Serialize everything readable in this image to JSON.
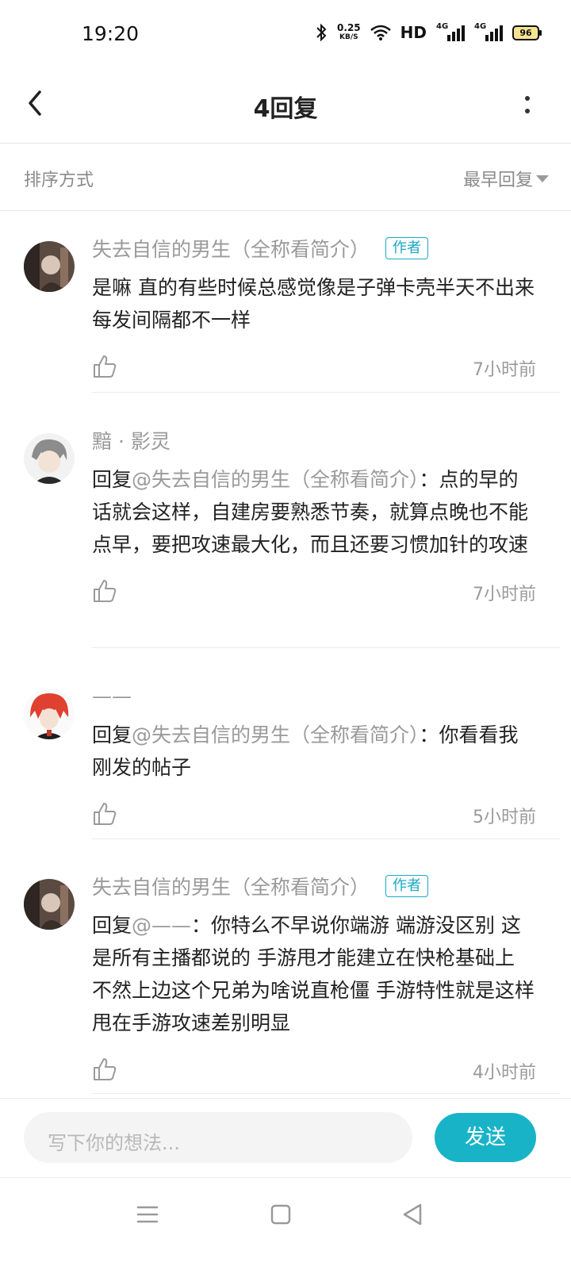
{
  "status_bar": {
    "time": "19:20",
    "net_speed_value": "0.25",
    "net_speed_unit": "KB/S",
    "hd_label": "HD",
    "network_1": "4G",
    "network_2": "4G",
    "battery": "96"
  },
  "header": {
    "title": "4回复",
    "back_icon": "chevron-left-icon",
    "more_icon": "more-vertical-icon"
  },
  "sort": {
    "label": "排序方式",
    "value": "最早回复"
  },
  "comments": [
    {
      "name": "失去自信的男生（全称看简介）",
      "badge": "作者",
      "mention": "",
      "text": "是嘛  直的有些时候总感觉像是子弹卡壳半天不出来 每发间隔都不一样",
      "time": "7小时前"
    },
    {
      "name": "黯 · 影灵",
      "badge": "",
      "prefix": "回复",
      "mention": "@失去自信的男生（全称看简介）",
      "text": "：点的早的话就会这样，自建房要熟悉节奏，就算点晚也不能点早，要把攻速最大化，而且还要习惯加针的攻速",
      "time": "7小时前"
    },
    {
      "name": "——",
      "badge": "",
      "prefix": "回复",
      "mention": "@失去自信的男生（全称看简介）",
      "text": "：你看看我刚发的帖子",
      "time": "5小时前"
    },
    {
      "name": "失去自信的男生（全称看简介）",
      "badge": "作者",
      "prefix": "回复",
      "mention": "@——",
      "text": "：你特么不早说你端游  端游没区别 这是所有主播都说的  手游甩才能建立在快枪基础上  不然上边这个兄弟为啥说直枪僵  手游特性就是这样 甩在手游攻速差别明显",
      "time": "4小时前"
    }
  ],
  "input_bar": {
    "placeholder": "写下你的想法...",
    "send_label": "发送"
  },
  "colors": {
    "accent": "#19b3c8",
    "muted_text": "#9a9a9a"
  }
}
